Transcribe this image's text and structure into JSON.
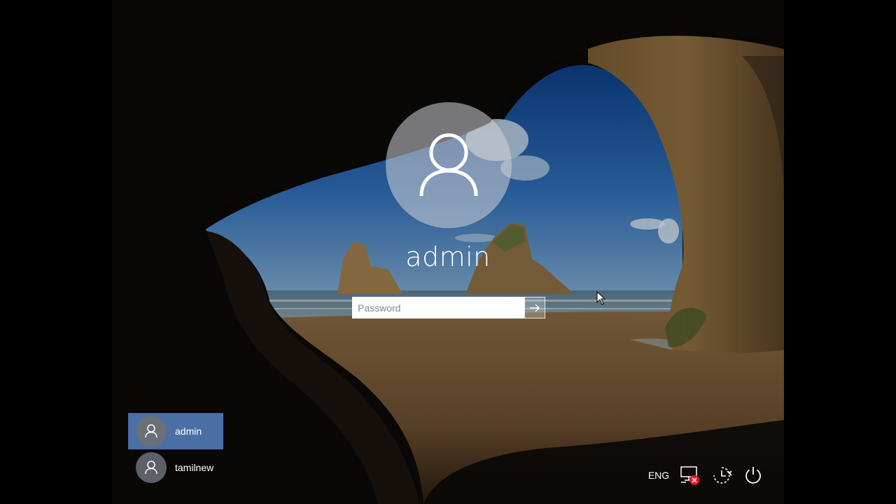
{
  "login": {
    "username": "admin",
    "password_placeholder": "Password"
  },
  "users": [
    {
      "name": "admin",
      "selected": true
    },
    {
      "name": "tamilnew",
      "selected": false
    }
  ],
  "tray": {
    "language": "ENG"
  },
  "icons": {
    "avatar": "user-icon",
    "submit": "arrow-right-icon",
    "network": "network-disconnected-icon",
    "ease_of_access": "ease-of-access-icon",
    "power": "power-icon"
  },
  "colors": {
    "selected_user_bg": "#4a6fa5",
    "network_error": "#e81123"
  }
}
